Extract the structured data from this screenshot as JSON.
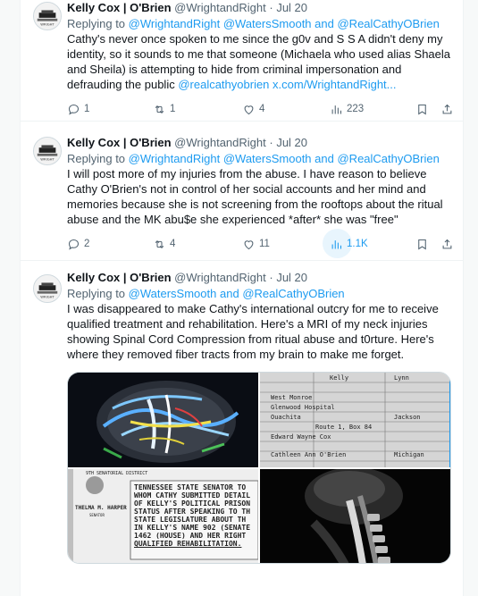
{
  "tweets": [
    {
      "author_name": "Kelly Cox | O'Brien",
      "handle": "@WrightandRight",
      "date": "Jul 20",
      "replying_prefix": "Replying to",
      "replying_mentions": "@WrightandRight @WatersSmooth",
      "replying_and": "and",
      "replying_last": "@RealCathyOBrien",
      "body_lines": [
        "Cathy's never once spoken to me since the g0v and S S A didn't deny my",
        "identity, so it sounds to me that someone (Michaela who used alias Shaela",
        "and Sheila) is attempting to hide from criminal impersonation and"
      ],
      "body_last_text": "defrauding the public",
      "body_last_links": "@realcathyobrien x.com/WrightandRight...",
      "actions": {
        "replies": "1",
        "reposts": "1",
        "likes": "4",
        "views": "223"
      }
    },
    {
      "author_name": "Kelly Cox | O'Brien",
      "handle": "@WrightandRight",
      "date": "Jul 20",
      "replying_prefix": "Replying to",
      "replying_mentions": "@WrightandRight @WatersSmooth",
      "replying_and": "and",
      "replying_last": "@RealCathyOBrien",
      "body_lines": [
        "I will post more of my injuries from the abuse. I have reason to believe",
        "Cathy O'Brien's not in control of her social accounts and her mind and",
        "memories because she is not screening from the rooftops about the ritual",
        "abuse and the MK abu$e she experienced *after* she was \"free\""
      ],
      "actions": {
        "replies": "2",
        "reposts": "4",
        "likes": "11",
        "views": "1.1K"
      }
    },
    {
      "author_name": "Kelly Cox | O'Brien",
      "handle": "@WrightandRight",
      "date": "Jul 20",
      "replying_prefix": "Replying to",
      "replying_mentions": "@WatersSmooth",
      "replying_and": "and",
      "replying_last": "@RealCathyOBrien",
      "body_lines": [
        "I was disappeared to make Cathy's international outcry for me to receive",
        "qualified treatment and rehabilitation. Here's a MRI of my neck injuries",
        "showing Spinal Cord Compression from ritual abuse and t0rture. Here's",
        "where they removed fiber tracts from my brain to make me forget."
      ]
    }
  ],
  "media": {
    "document_lines": [
      "Kelly",
      "Lynn",
      "West Monroe",
      "Glenwood Hospital",
      "Ouachita",
      "Jackson",
      "Route 1, Box 84",
      "Edward Wayne Cox",
      "Cathleen Ann O'Brien",
      "Michigan"
    ],
    "senator_lines": [
      "9TH SENATORIAL DISTRICT",
      "TENNESSEE STATE SENATOR TO",
      "WHOM CATHY SUBMITTED DETAIL",
      "OF KELLY'S POLITICAL PRISON",
      "STATUS AFTER SPEAKING TO TH",
      "STATE LEGISLATURE ABOUT TH",
      "IN KELLY'S NAME 902 (SENATE",
      "1462 (HOUSE) AND HER RIGHT",
      "QUALIFIED REHABILITATION.",
      "THELMA M. HARPER",
      "SENATOR"
    ]
  },
  "colors": {
    "link": "#1d9bf0",
    "muted": "#536471",
    "text": "#0f1419",
    "border": "#eff3f4"
  },
  "icons": [
    "reply-icon",
    "repost-icon",
    "like-icon",
    "views-icon",
    "bookmark-icon",
    "share-icon"
  ]
}
